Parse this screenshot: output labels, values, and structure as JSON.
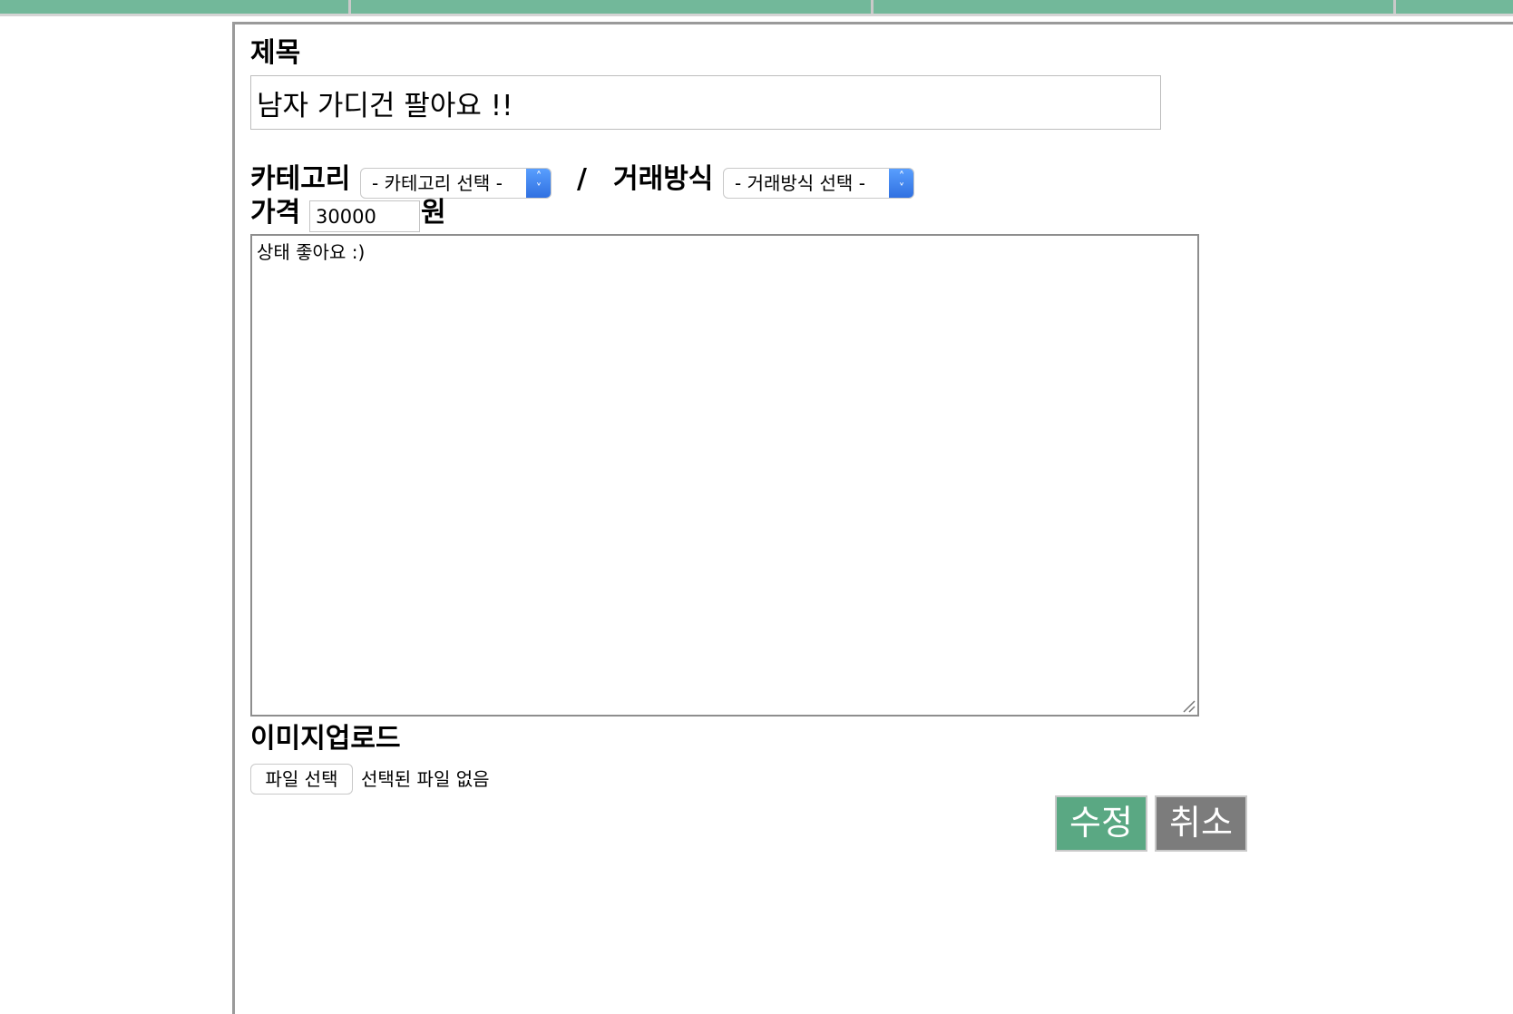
{
  "colors": {
    "nav_green": "#72b89a",
    "submit_green": "#5aa883",
    "cancel_gray": "#7c7c7c",
    "select_blue": "#3b82f6"
  },
  "form": {
    "title_label": "제목",
    "title_value": "남자 가디건 팔아요 !!",
    "category_label": "카테고리",
    "category_selected": "- 카테고리 선택 -",
    "separator": "/",
    "trade_label": "거래방식",
    "trade_selected": "- 거래방식 선택 -",
    "price_label": "가격",
    "price_value": "30000",
    "price_unit": "원",
    "description_value": "상태 좋아요 :)",
    "image_label": "이미지업로드",
    "file_button_label": "파일 선택",
    "file_status": "선택된 파일 없음"
  },
  "actions": {
    "submit_label": "수정",
    "cancel_label": "취소"
  },
  "icons": {
    "select_arrow": "chevron-up-down-icon",
    "resize": "resize-grip-icon"
  }
}
